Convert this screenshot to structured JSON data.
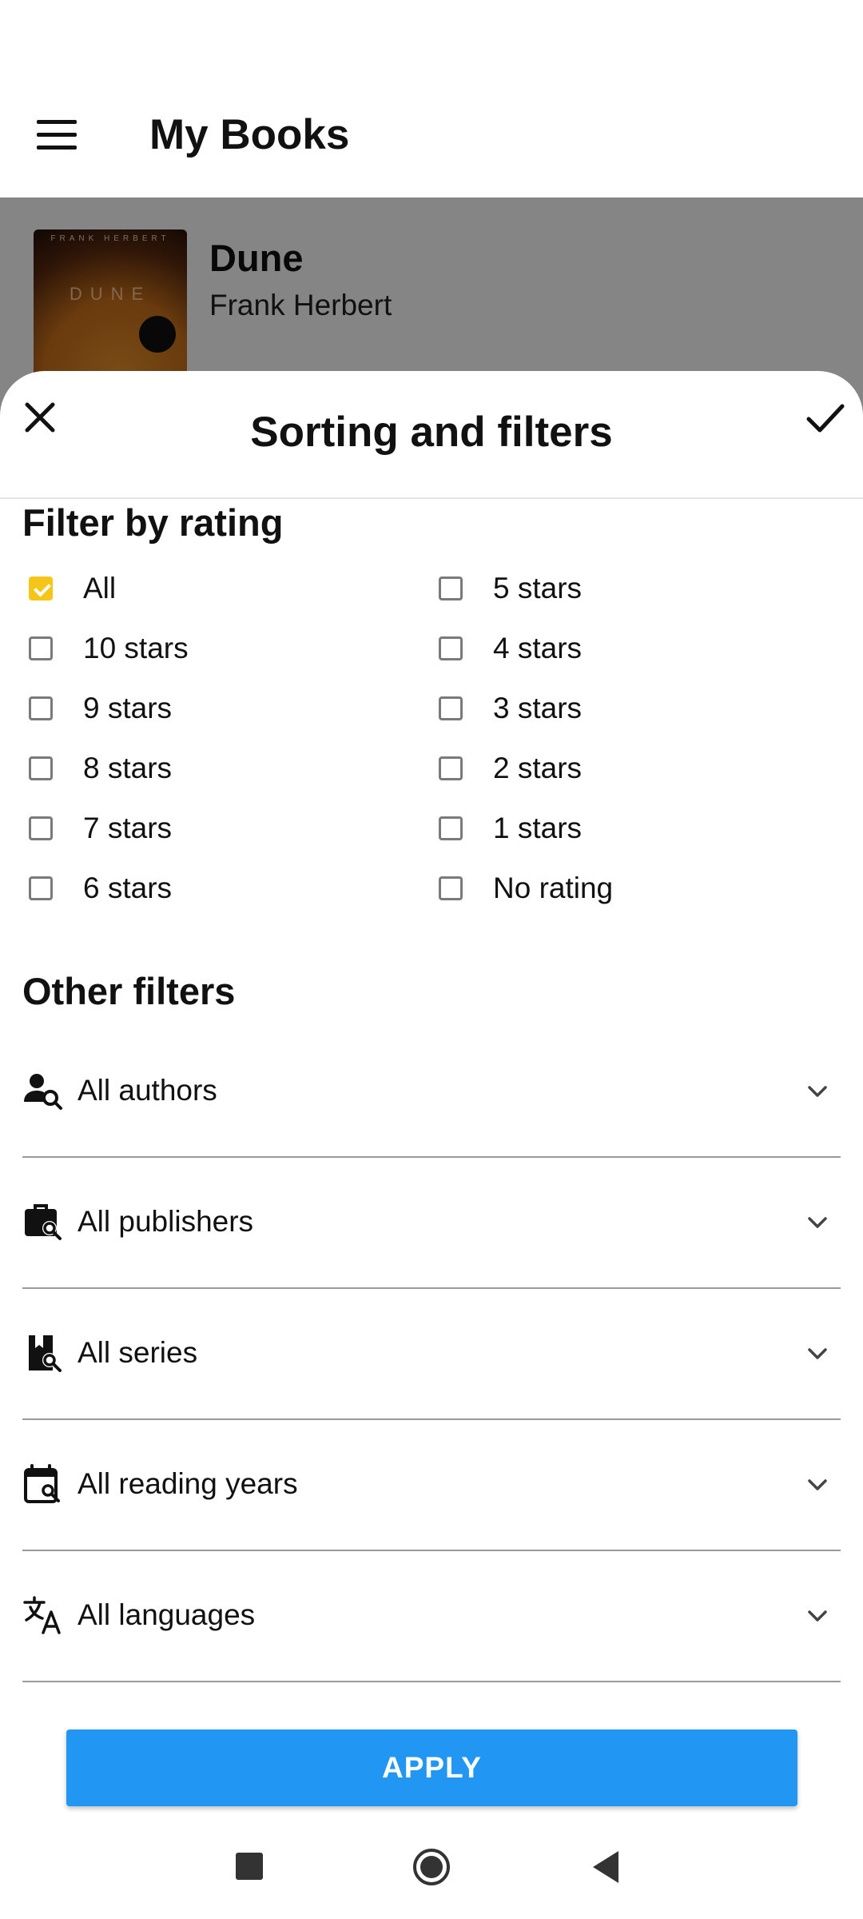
{
  "appbar": {
    "title": "My Books"
  },
  "book": {
    "cover_top": "FRANK HERBERT",
    "cover_title": "DUNE",
    "title": "Dune",
    "author": "Frank Herbert"
  },
  "sheet": {
    "title": "Sorting and filters"
  },
  "rating": {
    "title": "Filter by rating",
    "left": [
      {
        "label": "All",
        "checked": true
      },
      {
        "label": "10 stars",
        "checked": false
      },
      {
        "label": "9 stars",
        "checked": false
      },
      {
        "label": "8 stars",
        "checked": false
      },
      {
        "label": "7 stars",
        "checked": false
      },
      {
        "label": "6 stars",
        "checked": false
      }
    ],
    "right": [
      {
        "label": "5 stars",
        "checked": false
      },
      {
        "label": "4 stars",
        "checked": false
      },
      {
        "label": "3 stars",
        "checked": false
      },
      {
        "label": "2 stars",
        "checked": false
      },
      {
        "label": "1 stars",
        "checked": false
      },
      {
        "label": "No rating",
        "checked": false
      }
    ]
  },
  "other": {
    "title": "Other filters",
    "rows": [
      {
        "label": "All authors",
        "icon": "author-search-icon"
      },
      {
        "label": "All publishers",
        "icon": "publisher-search-icon"
      },
      {
        "label": "All series",
        "icon": "series-search-icon"
      },
      {
        "label": "All reading years",
        "icon": "calendar-search-icon"
      },
      {
        "label": "All languages",
        "icon": "translate-icon"
      }
    ]
  },
  "apply_label": "APPLY",
  "colors": {
    "accent": "#f5c518",
    "primary": "#2196f3"
  }
}
